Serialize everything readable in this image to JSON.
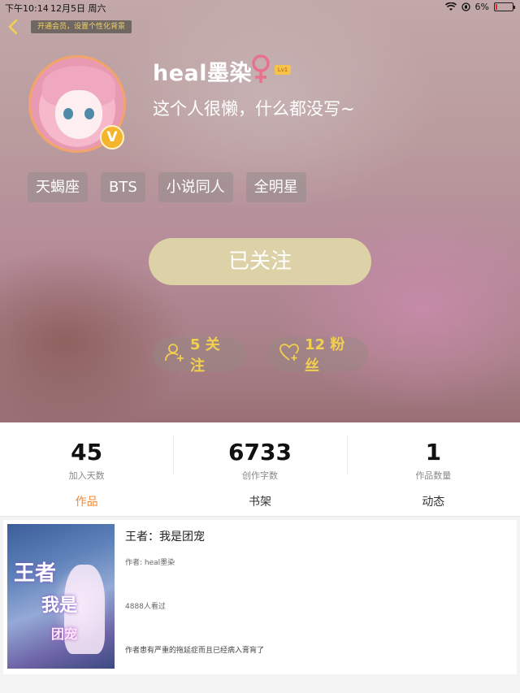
{
  "status_bar": {
    "time": "下午10:14",
    "date": "12月5日 周六",
    "battery": "6%",
    "battery_level": 0.06
  },
  "header": {
    "back_icon": "chevron-left-icon",
    "vip_banner": "开通会员，设置个性化背景"
  },
  "profile": {
    "username": "heal墨染",
    "gender_symbol": "♀",
    "level": "Lv1",
    "v_badge": "V",
    "bio": "这个人很懒，什么都没写~"
  },
  "tags": [
    "天蝎座",
    "BTS",
    "小说同人",
    "全明星"
  ],
  "follow_button": "已关注",
  "social": {
    "following": "5 关注",
    "fans": "12 粉丝"
  },
  "stats": [
    {
      "value": "45",
      "label": "加入天数"
    },
    {
      "value": "6733",
      "label": "创作字数"
    },
    {
      "value": "1",
      "label": "作品数量"
    }
  ],
  "tabs": [
    {
      "label": "作品",
      "active": true
    },
    {
      "label": "书架",
      "active": false
    },
    {
      "label": "动态",
      "active": false
    }
  ],
  "work": {
    "title": "王者：我是团宠",
    "author": "作者: heal墨染",
    "views": "4888人看过",
    "description": "作者患有严重的拖延症而且已经病入膏肓了",
    "cover_text": [
      "王者",
      "我是",
      "团宠"
    ]
  },
  "colors": {
    "accent_orange": "#f08a3a",
    "social_yellow": "#f3cf4f",
    "follow_button_bg": "#ddd1a8",
    "gender_pink": "#e8718e"
  }
}
